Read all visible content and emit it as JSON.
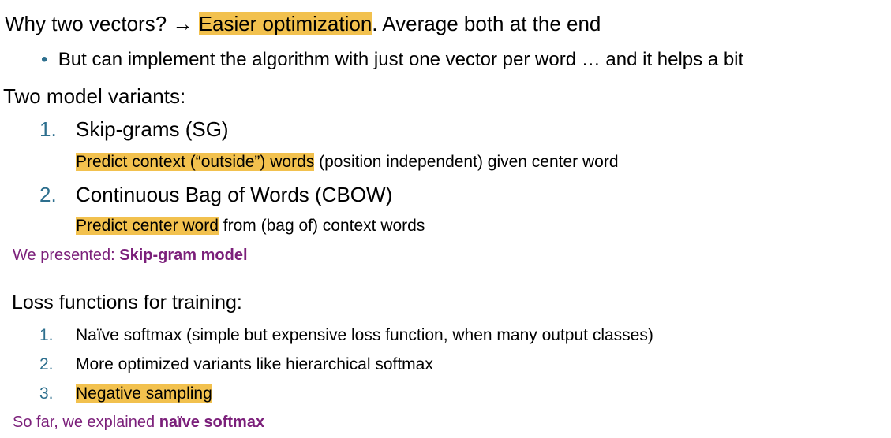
{
  "colors": {
    "highlight": "#f2c14e",
    "number": "#2d6f8e",
    "note": "#7b1f7a"
  },
  "line1": {
    "prefix": "Why two vectors? ",
    "arrow": "→",
    "highlight": "Easier optimization",
    "suffix": ". Average both at the end"
  },
  "bullet1": {
    "symbol": "•",
    "text": "But can implement the algorithm with just one vector per word … and it helps a bit"
  },
  "variants_heading": "Two model variants:",
  "variants": [
    {
      "number": "1.",
      "title": "Skip-grams (SG)",
      "desc_highlight": "Predict context (“outside”) words",
      "desc_rest": " (position independent) given center word"
    },
    {
      "number": "2.",
      "title": "Continuous Bag of Words (CBOW)",
      "desc_highlight": "Predict center word",
      "desc_rest": " from (bag of) context words"
    }
  ],
  "presented": {
    "prefix": "We presented: ",
    "bold": "Skip-gram model"
  },
  "loss_heading": "Loss functions for training:",
  "loss_items": [
    {
      "number": "1.",
      "text": "Naïve softmax (simple but expensive loss function, when many output classes)"
    },
    {
      "number": "2.",
      "text": "More optimized variants like hierarchical softmax"
    },
    {
      "number": "3.",
      "text": "Negative sampling"
    }
  ],
  "explained": {
    "prefix": "So far, we explained ",
    "bold": "naïve softmax"
  }
}
